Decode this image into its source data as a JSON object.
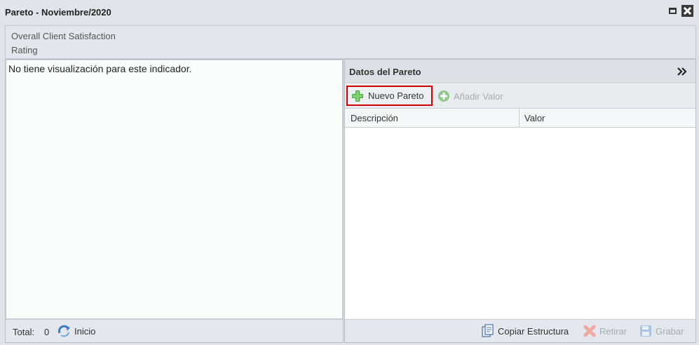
{
  "window": {
    "title": "Pareto - Noviembre/2020"
  },
  "header": {
    "line1": "Overall Client Satisfaction",
    "line2": "Rating"
  },
  "left": {
    "message": "No tiene visualización para este indicador.",
    "footer": {
      "total_label": "Total:",
      "total_value": "0",
      "inicio_label": "Inicio",
      "inicio_icon": "refresh-icon"
    }
  },
  "right": {
    "title": "Datos del Pareto",
    "collapse_icon": "double-chevron-right-icon",
    "toolbar": {
      "nuevo_label": "Nuevo Pareto",
      "nuevo_icon": "green-plus-icon",
      "anadir_label": "Añadir Valor",
      "anadir_icon": "add-circle-icon"
    },
    "grid": {
      "columns": [
        "Descripción",
        "Valor"
      ],
      "rows": []
    },
    "footer": {
      "copiar_label": "Copiar Estructura",
      "retirar_label": "Retirar",
      "grabar_label": "Grabar"
    }
  },
  "colors": {
    "highlight_border": "#d00000",
    "disabled_text": "#a6abb0",
    "add_green": "#4caf50"
  }
}
